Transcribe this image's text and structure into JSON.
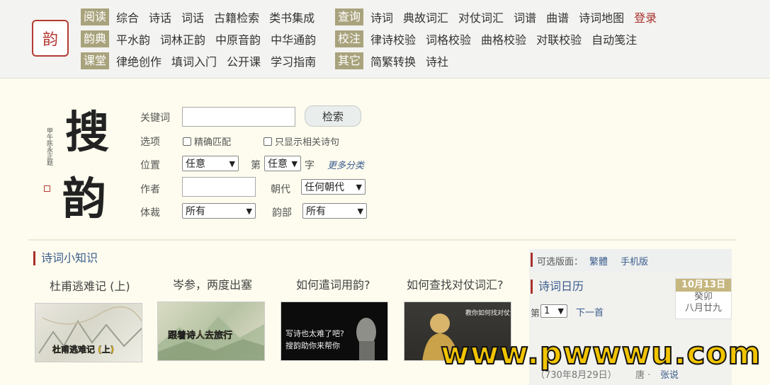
{
  "header": {
    "rows": [
      {
        "left_category": "阅读",
        "left_links": [
          "综合",
          "诗话",
          "词话",
          "古籍检索",
          "类书集成"
        ],
        "right_category": "查询",
        "right_links": [
          "诗词",
          "典故词汇",
          "对仗词汇",
          "词谱",
          "曲谱",
          "诗词地图"
        ],
        "login": "登录"
      },
      {
        "left_category": "韵典",
        "left_links": [
          "平水韵",
          "词林正韵",
          "中原音韵",
          "中华通韵"
        ],
        "right_category": "校注",
        "right_links": [
          "律诗校验",
          "词格校验",
          "曲格校验",
          "对联校验",
          "自动笺注"
        ]
      },
      {
        "left_category": "课堂",
        "left_links": [
          "律绝创作",
          "填词入门",
          "公开课",
          "学习指南"
        ],
        "right_category": "其它",
        "right_links": [
          "简繁转换",
          "诗社"
        ]
      }
    ]
  },
  "search": {
    "keyword_label": "关键词",
    "keyword_value": "",
    "search_button": "检索",
    "options_label": "选项",
    "exact_match": "精确匹配",
    "only_related": "只显示相关诗句",
    "position_label": "位置",
    "position_value": "任意",
    "nth_label": "第",
    "nth_value": "任意",
    "char_label": "字",
    "more_categories": "更多分类",
    "author_label": "作者",
    "author_value": "",
    "dynasty_label": "朝代",
    "dynasty_value": "任何朝代",
    "genre_label": "体裁",
    "genre_value": "所有",
    "rhyme_label": "韵部",
    "rhyme_value": "所有"
  },
  "logo": {
    "char1": "搜",
    "char2": "韵"
  },
  "knowledge": {
    "title": "诗词小知识",
    "cards": [
      {
        "title": "杜甫逃难记 (上)",
        "caption": "杜甫逃难记 (上)"
      },
      {
        "title": "岑参，两度出塞",
        "caption": "跟着诗人去旅行"
      },
      {
        "title": "如何遣词用韵?",
        "caption": "写诗也太难了吧? 搜韵助你来帮你"
      },
      {
        "title": "如何查找对仗词汇?",
        "caption": "教你如何找对仗词汇"
      }
    ]
  },
  "sidebar": {
    "version_label": "可选版面：",
    "traditional": "繁體",
    "mobile": "手机版",
    "calendar_title": "诗词日历",
    "date": "10月13日",
    "ganzhi": "癸卯",
    "lunar": "八月廿九",
    "page_label": "第",
    "page_value": "1",
    "next_link": "下一首",
    "poem_meta": "（730年8月29日）",
    "poem_dynasty": "唐 ·",
    "poem_author": "张说"
  },
  "watermark": "www.pwwwu.com",
  "colors": {
    "category_bg": "#a9a37d",
    "link_blue": "#3a5c8c",
    "accent_red": "#a8312b",
    "page_bg": "#fdfcee"
  }
}
